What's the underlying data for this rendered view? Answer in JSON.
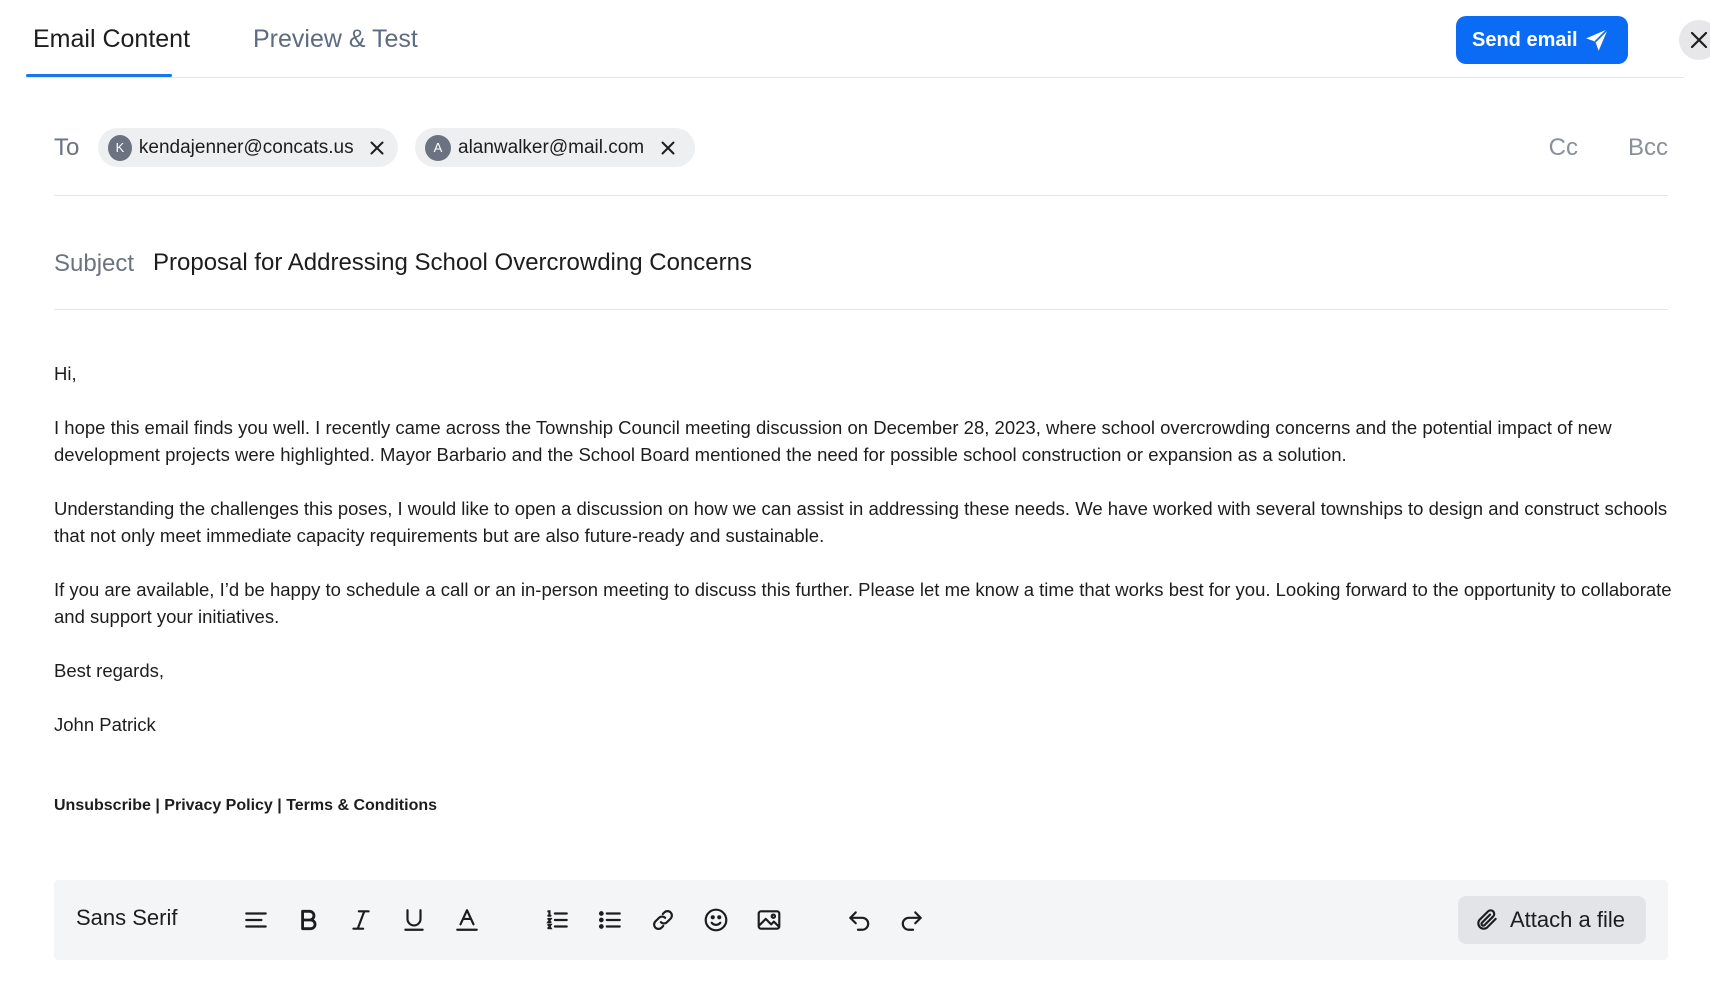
{
  "tabs": [
    {
      "label": "Email Content",
      "active": true
    },
    {
      "label": "Preview & Test",
      "active": false
    }
  ],
  "send_button": {
    "label": "Send email",
    "icon": "send-icon"
  },
  "close_icon": "close-icon",
  "to": {
    "label": "To",
    "recipients": [
      {
        "initial": "K",
        "email": "kendajenner@concats.us"
      },
      {
        "initial": "A",
        "email": "alanwalker@mail.com"
      }
    ],
    "cc_label": "Cc",
    "bcc_label": "Bcc"
  },
  "subject": {
    "label": "Subject",
    "value": "Proposal for Addressing School Overcrowding Concerns"
  },
  "body": {
    "greeting": "Hi,",
    "paragraphs": [
      "I hope this email finds you well. I recently came across the Township Council meeting discussion on December 28, 2023, where school overcrowding concerns and the potential impact of new development projects were highlighted. Mayor Barbario and the School Board mentioned the need for possible school construction or expansion as a solution.",
      "Understanding the challenges this poses, I would like to open a discussion on how we can assist in addressing these needs. We have worked with several townships to design and construct schools that not only meet immediate capacity requirements but are also future-ready and sustainable.",
      "If you are available, I’d be happy to schedule a call or an in-person meeting to discuss this further. Please let me know a time that works best for you. Looking forward to the opportunity to collaborate and support your initiatives."
    ],
    "closing": "Best regards,",
    "signature": "John Patrick"
  },
  "footer": {
    "unsubscribe": "Unsubscribe",
    "privacy": "Privacy Policy",
    "terms": "Terms & Conditions",
    "separator": " | "
  },
  "toolbar": {
    "font": "Sans Serif",
    "icons": [
      "align-left-icon",
      "bold-icon",
      "italic-icon",
      "underline-icon",
      "text-color-icon",
      "ordered-list-icon",
      "bullet-list-icon",
      "link-icon",
      "emoji-icon",
      "image-icon",
      "undo-icon",
      "redo-icon"
    ],
    "attach_label": "Attach a file"
  },
  "colors": {
    "accent": "#0a6cf5",
    "tab_underline": "#1677ee"
  }
}
